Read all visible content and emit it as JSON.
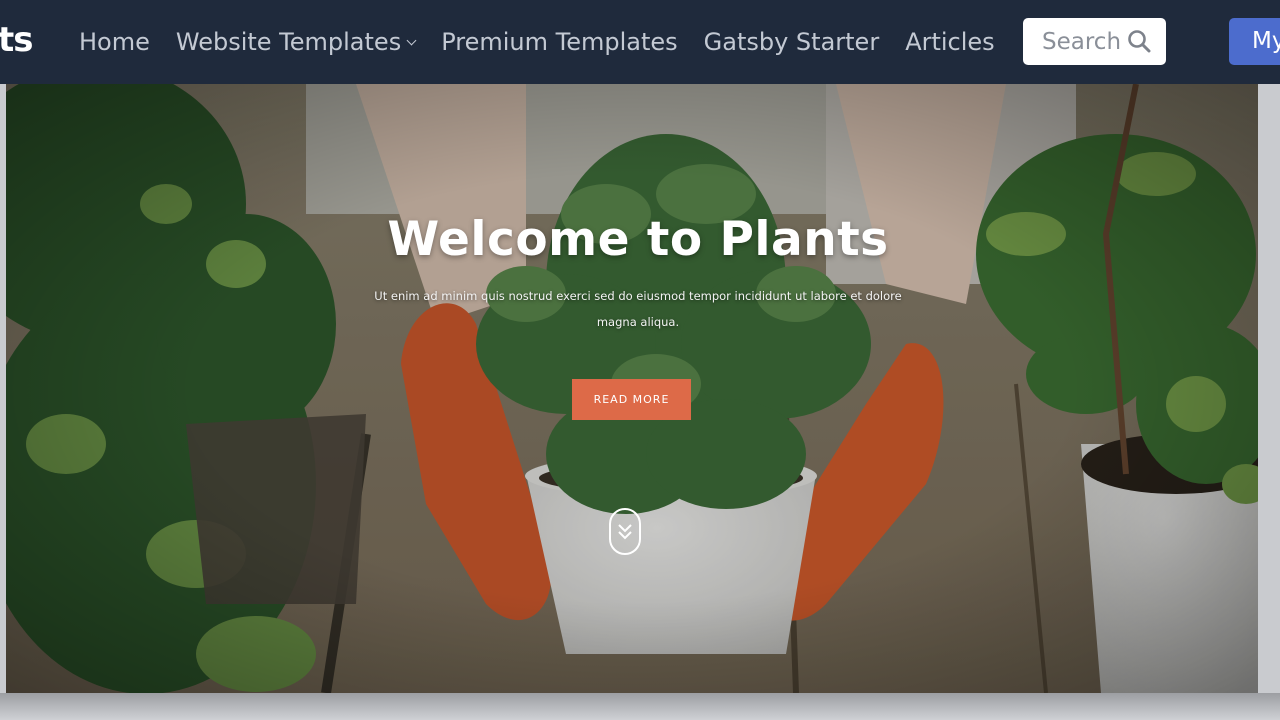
{
  "brand": {
    "text": "ts"
  },
  "nav": {
    "items": [
      {
        "label": "Home"
      },
      {
        "label": "Website Templates",
        "dropdown": true
      },
      {
        "label": "Premium Templates"
      },
      {
        "label": "Gatsby Starter"
      },
      {
        "label": "Articles"
      }
    ]
  },
  "search": {
    "placeholder": "Search",
    "icon": "search-icon"
  },
  "account_button": {
    "label": "My"
  },
  "hero": {
    "title": "Welcome to Plants",
    "subtitle": "Ut enim ad minim quis nostrud exerci sed do eiusmod tempor incididunt ut labore et dolore magna aliqua.",
    "cta_label": "READ MORE",
    "scroll_icon": "chevrons-down-icon"
  },
  "colors": {
    "nav_bg": "#1f2a3c",
    "nav_text": "#c3c9d3",
    "accent_button": "#4c6ccd",
    "cta": "#dd6a48"
  }
}
